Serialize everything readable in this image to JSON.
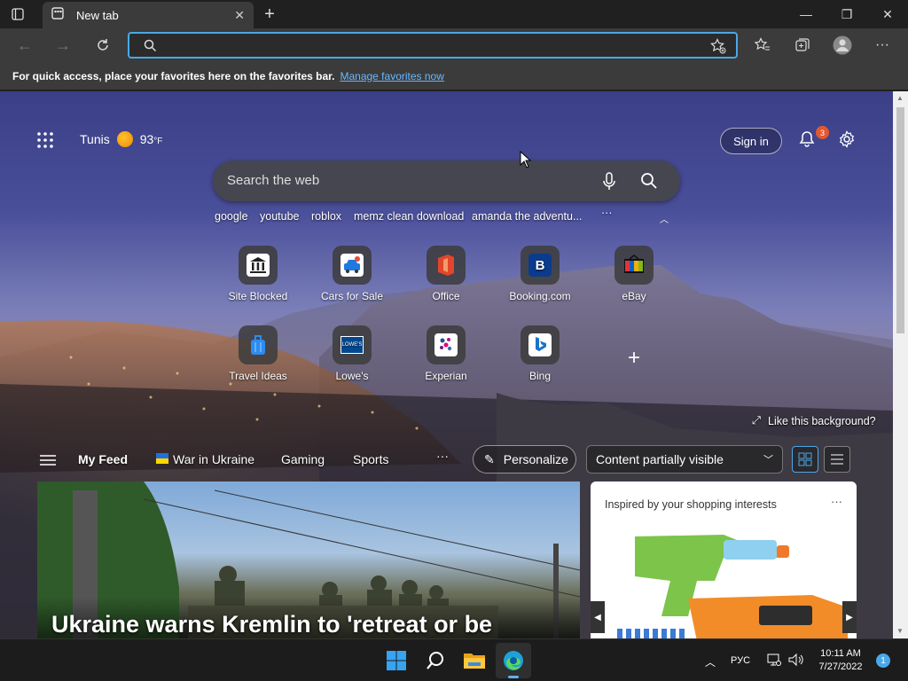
{
  "browser": {
    "tab_title": "New tab",
    "address_value": "",
    "favorites_message": "For quick access, place your favorites here on the favorites bar.",
    "favorites_link": "Manage favorites now"
  },
  "newtab": {
    "weather_city": "Tunis",
    "weather_temp": "93",
    "weather_unit": "°F",
    "sign_in": "Sign in",
    "notif_count": "3",
    "search_placeholder": "Search the web",
    "suggestions": [
      "google",
      "youtube",
      "roblox",
      "memz clean download",
      "amanda the adventu..."
    ],
    "more": "···",
    "tiles": [
      {
        "label": "Site Blocked",
        "icon": "bank-icon"
      },
      {
        "label": "Cars for Sale",
        "icon": "car-icon"
      },
      {
        "label": "Office",
        "icon": "office-icon"
      },
      {
        "label": "Booking.com",
        "icon": "booking-icon"
      },
      {
        "label": "eBay",
        "icon": "ebay-icon"
      },
      {
        "label": "Travel Ideas",
        "icon": "luggage-icon"
      },
      {
        "label": "Lowe's",
        "icon": "lowes-icon"
      },
      {
        "label": "Experian",
        "icon": "experian-icon"
      },
      {
        "label": "Bing",
        "icon": "bing-icon"
      }
    ],
    "like_bg": "Like this background?",
    "feed_tabs": [
      "My Feed",
      "War in Ukraine",
      "Gaming",
      "Sports"
    ],
    "personalize": "Personalize",
    "content_visibility": "Content partially visible",
    "headline": "Ukraine warns Kremlin to 'retreat or be",
    "shopping_title": "Inspired by your shopping interests",
    "shopping_more": "···"
  },
  "taskbar": {
    "lang": "РУС",
    "time": "10:11 AM",
    "date": "7/27/2022",
    "notif_badge": "1"
  }
}
